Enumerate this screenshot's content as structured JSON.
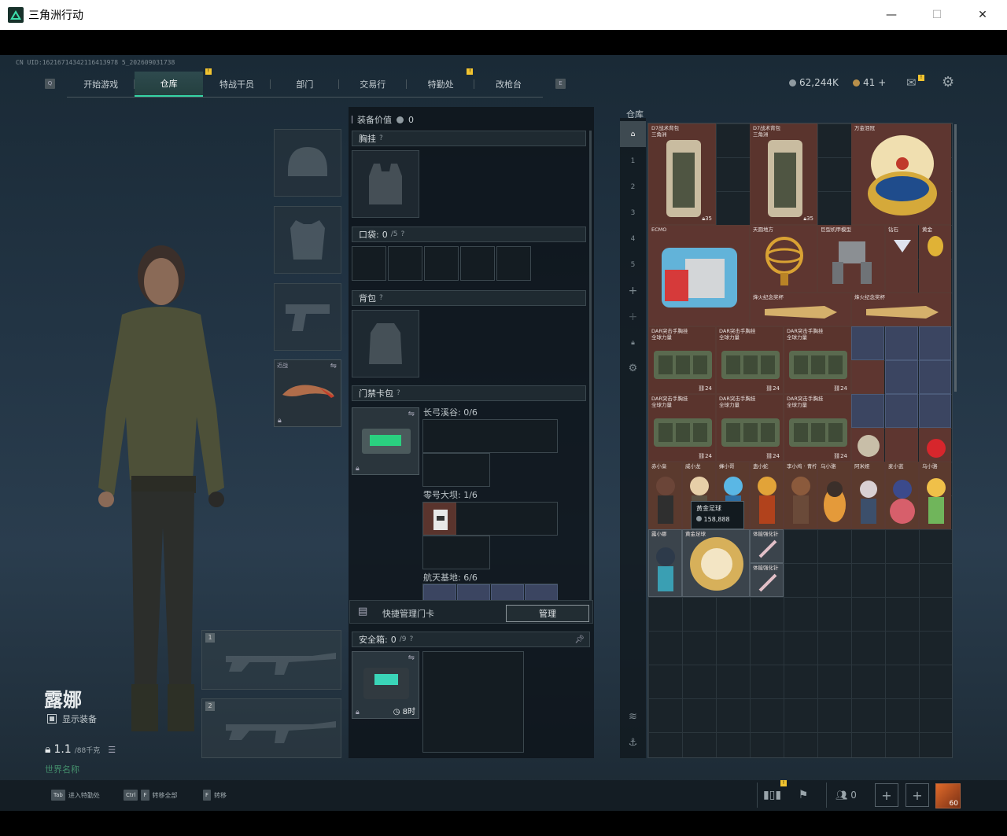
{
  "window": {
    "title": "三角洲行动",
    "minimize": "—",
    "maximize": "☐",
    "close": "✕"
  },
  "uid": "CN UID:16216714342116413978 5_202609031738",
  "nav": {
    "left_key": "Q",
    "right_key": "E",
    "tabs": [
      "开始游戏",
      "仓库",
      "特战干员",
      "部门",
      "交易行",
      "特勤处",
      "改枪台"
    ],
    "active_index": 1,
    "badges": [
      "!",
      "!"
    ]
  },
  "currency": {
    "coins": "62,244K",
    "tokens": "41",
    "plus": "+"
  },
  "character": {
    "name": "露娜",
    "show_equipment": "显示装备",
    "weight_value": "1.1",
    "weight_unit": "/88千克",
    "world": "世界名称"
  },
  "equip": {
    "melee_label": "近战",
    "slot1": "1",
    "slot2": "2"
  },
  "middle": {
    "value_label": "装备价值",
    "value": "0",
    "chest": "胸挂",
    "pockets": "口袋:",
    "pockets_count": "0",
    "pockets_max": "/5",
    "backpack": "背包",
    "keycard": "门禁卡包",
    "maps": [
      {
        "name": "长弓溪谷: 0/6"
      },
      {
        "name": "零号大坝: 1/6"
      },
      {
        "name": "航天基地: 6/6"
      }
    ],
    "quick_manage": "快捷管理门卡",
    "manage_btn": "管理",
    "safe": "安全箱:",
    "safe_count": "0",
    "safe_max": "/9",
    "safe_timer": "8时"
  },
  "warehouse": {
    "label": "仓库",
    "side_tabs": [
      "全部",
      "1",
      "2",
      "3",
      "4",
      "5",
      "+",
      "+",
      "锁",
      "设置",
      "层",
      "锚"
    ],
    "items": [
      {
        "name": "D7战术背包\n三角洲",
        "count": "35",
        "variant": "green"
      },
      {
        "name": "D7战术背包\n三角洲",
        "count": "35",
        "variant": "green"
      },
      {
        "name": "万金泪冠",
        "count": "",
        "variant": "gold"
      },
      {
        "name": "ECMO",
        "count": "",
        "variant": "gold"
      },
      {
        "name": "天圆地方",
        "count": "",
        "variant": "gold"
      },
      {
        "name": "巨型机甲模型",
        "count": "",
        "variant": "gold"
      },
      {
        "name": "钻石",
        "count": "",
        "variant": "gold"
      },
      {
        "name": "黄金",
        "count": "",
        "variant": "gold"
      },
      {
        "name": "烽火纪念奖杯",
        "count": "",
        "variant": "gold"
      },
      {
        "name": "烽火纪念奖杯",
        "count": "",
        "variant": "gold"
      },
      {
        "name": "DAR突击手胸挂\n全球力量",
        "count": "24",
        "variant": "green"
      },
      {
        "name": "DAR突击手胸挂\n全球力量",
        "count": "24",
        "variant": "green"
      },
      {
        "name": "DAR突击手胸挂\n全球力量",
        "count": "24",
        "variant": "green"
      },
      {
        "name": "DAR突击手胸挂\n全球力量",
        "count": "24",
        "variant": "green"
      },
      {
        "name": "DAR突击手胸挂\n全球力量",
        "count": "24",
        "variant": "green"
      },
      {
        "name": "DAR突击手胸挂\n全球力量",
        "count": "24",
        "variant": "green"
      },
      {
        "name": "赤小枭",
        "count": "",
        "variant": "brown"
      },
      {
        "name": "威小龙",
        "count": "",
        "variant": "brown"
      },
      {
        "name": "蜂小哥",
        "count": "",
        "variant": "brown"
      },
      {
        "name": "蛊小蛇",
        "count": "",
        "variant": "brown"
      },
      {
        "name": "李小鸠 · 青柠",
        "count": "",
        "variant": "brown"
      },
      {
        "name": "乌小骆",
        "count": "",
        "variant": "brown"
      },
      {
        "name": "阿米娅",
        "count": "",
        "variant": "brown"
      },
      {
        "name": "麦小蓝",
        "count": "",
        "variant": "brown"
      },
      {
        "name": "乌小骆",
        "count": "",
        "variant": "brown"
      },
      {
        "name": "露小娜",
        "count": "",
        "variant": "grey"
      },
      {
        "name": "黄金足球",
        "count": "",
        "variant": "grey"
      },
      {
        "name": "体能强化针",
        "count": "",
        "variant": "grey"
      },
      {
        "name": "体能强化针",
        "count": "",
        "variant": "grey"
      }
    ],
    "tooltip_name": "黄金足球",
    "tooltip_value": "158,888"
  },
  "footer": {
    "k1": "Tab",
    "l1": "进入特勤处",
    "k2": "Ctrl",
    "k2b": "F",
    "l2": "转移全部",
    "k3": "F",
    "l3": "转移",
    "squad": "0",
    "level": "60"
  },
  "colors": {
    "accent": "#35d3a4",
    "badge": "#f2c430",
    "item_red": "#5a2d28"
  }
}
